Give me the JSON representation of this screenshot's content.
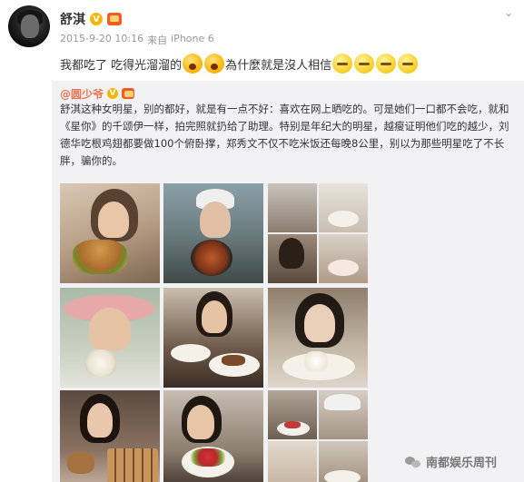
{
  "post": {
    "author": "舒淇",
    "time": "2015-9-20 10:16",
    "source_prefix": "来自",
    "source": "iPhone 6",
    "text_part1": "我都吃了 吃得光溜溜的",
    "text_part2": "為什麼就是沒人相信",
    "emojis": [
      "shock-emoji",
      "shock-emoji",
      "sleepy-emoji",
      "sleepy-emoji",
      "sleepy-emoji",
      "sleepy-emoji"
    ]
  },
  "repost": {
    "author": "@圆少爷",
    "text": "舒淇这种女明星，别的都好，就是有一点不好：喜欢在网上晒吃的。可是她们一口都不会吃，就和《星你》的千颂伊一样，拍完照就扔给了助理。特别是年纪大的明星，越瘦证明他们吃的越少，刘德华吃根鸡翅都要做100个俯卧撑，郑秀文不仅不吃米饭还每晚8公里，别以为那些明星吃了不长胖，骗你的。",
    "photos": [
      "photo-burger",
      "photo-cap-bowl",
      "photo-collage-1",
      "photo-pink-hat",
      "photo-dessert-plate",
      "photo-cake",
      "photo-chocolates",
      "photo-fruit-plate",
      "photo-collage-2"
    ]
  },
  "watermark": "南都娱乐周刊",
  "colors": {
    "repost_name": "#eb7350",
    "verified_badge": "#f7b500",
    "vip_badge": "#f35b1f",
    "repost_bg": "#f2f2f5"
  }
}
